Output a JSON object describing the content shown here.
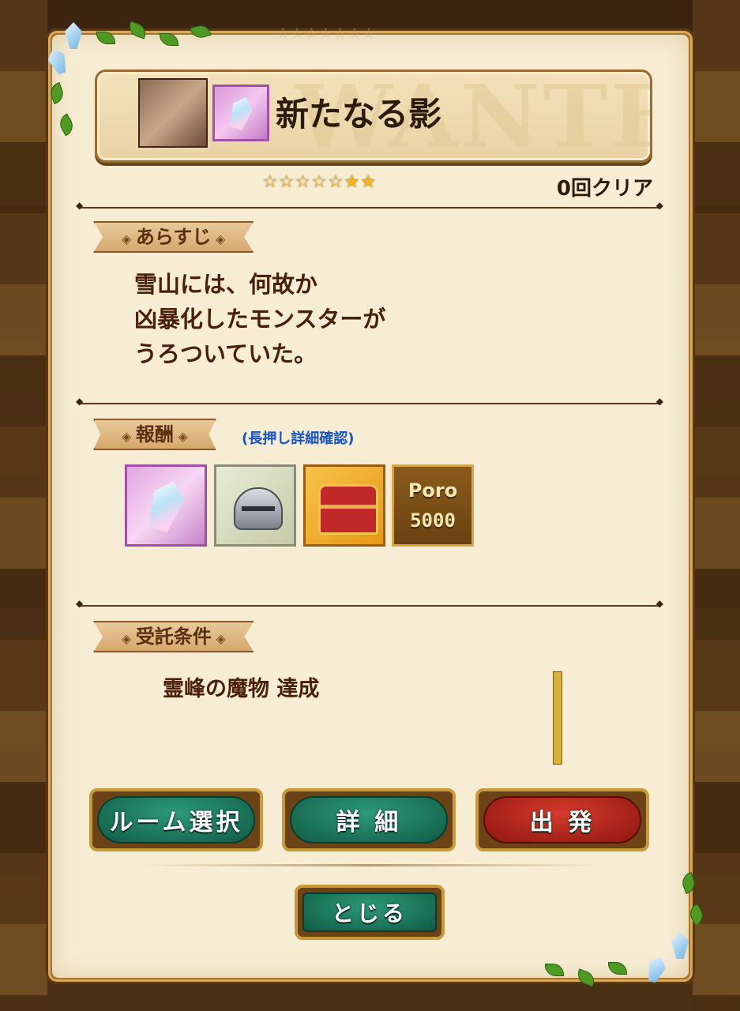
{
  "header": {
    "faint_stars": "☆☆☆☆☆☆☆",
    "title": "新たなる影",
    "watermark": "WANTED",
    "stars": "☆☆☆☆☆★★",
    "clear_count": "0回クリア"
  },
  "story": {
    "label": "あらすじ",
    "lines": [
      "雪山には、何故か",
      "凶暴化したモンスターが",
      "うろついていた。"
    ]
  },
  "rewards": {
    "label": "報酬",
    "hint": "(長押し詳細確認)",
    "items": [
      {
        "icon": "crystal-icon"
      },
      {
        "icon": "helmet-icon"
      },
      {
        "icon": "treasure-chest-icon"
      },
      {
        "icon": "poro-currency-icon",
        "label": "Poro",
        "amount": "5000"
      }
    ]
  },
  "conditions": {
    "label": "受託条件",
    "text": "霊峰の魔物 達成"
  },
  "buttons": {
    "room_select": "ルーム選択",
    "details": "詳 細",
    "depart": "出 発",
    "close": "とじる"
  },
  "colors": {
    "panel": "#f6edd4",
    "frame": "#a8742b",
    "green_button": "#1a7a5c",
    "red_button": "#b3241b",
    "hint_blue": "#1a55c8",
    "text_brown": "#4a1f08"
  }
}
